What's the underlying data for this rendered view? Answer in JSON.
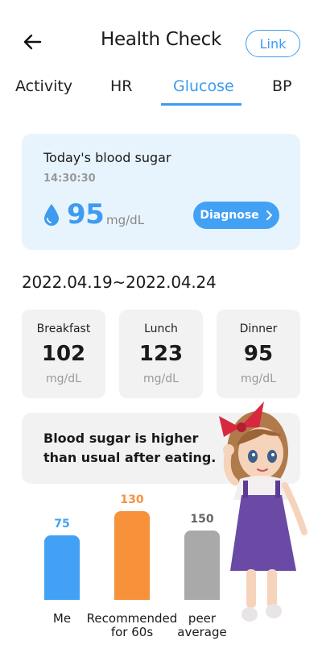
{
  "header": {
    "title": "Health Check",
    "link_label": "Link"
  },
  "tabs": [
    {
      "label": "Activity",
      "active": false
    },
    {
      "label": "HR",
      "active": false
    },
    {
      "label": "Glucose",
      "active": true
    },
    {
      "label": "BP",
      "active": false
    }
  ],
  "today": {
    "title": "Today's blood sugar",
    "time": "14:30:30",
    "value": "95",
    "unit": "mg/dL",
    "diagnose_label": "Diagnose"
  },
  "date_range": "2022.04.19~2022.04.24",
  "meals": [
    {
      "label": "Breakfast",
      "value": "102",
      "unit": "mg/dL"
    },
    {
      "label": "Lunch",
      "value": "123",
      "unit": "mg/dL"
    },
    {
      "label": "Dinner",
      "value": "95",
      "unit": "mg/dL"
    }
  ],
  "message": "Blood sugar is higher than usual after eating.",
  "comparison": {
    "bars": [
      {
        "label": "Me",
        "value": 75,
        "color": "#42a1f4"
      },
      {
        "label": "Recommended for 60s",
        "value": 130,
        "color": "#f7913a"
      },
      {
        "label": "peer average",
        "value": 150,
        "color": "#a9a9a9"
      }
    ]
  },
  "colors": {
    "accent": "#3d9bf0",
    "card_blue": "#e8f4fd",
    "card_gray": "#f2f2f2"
  }
}
